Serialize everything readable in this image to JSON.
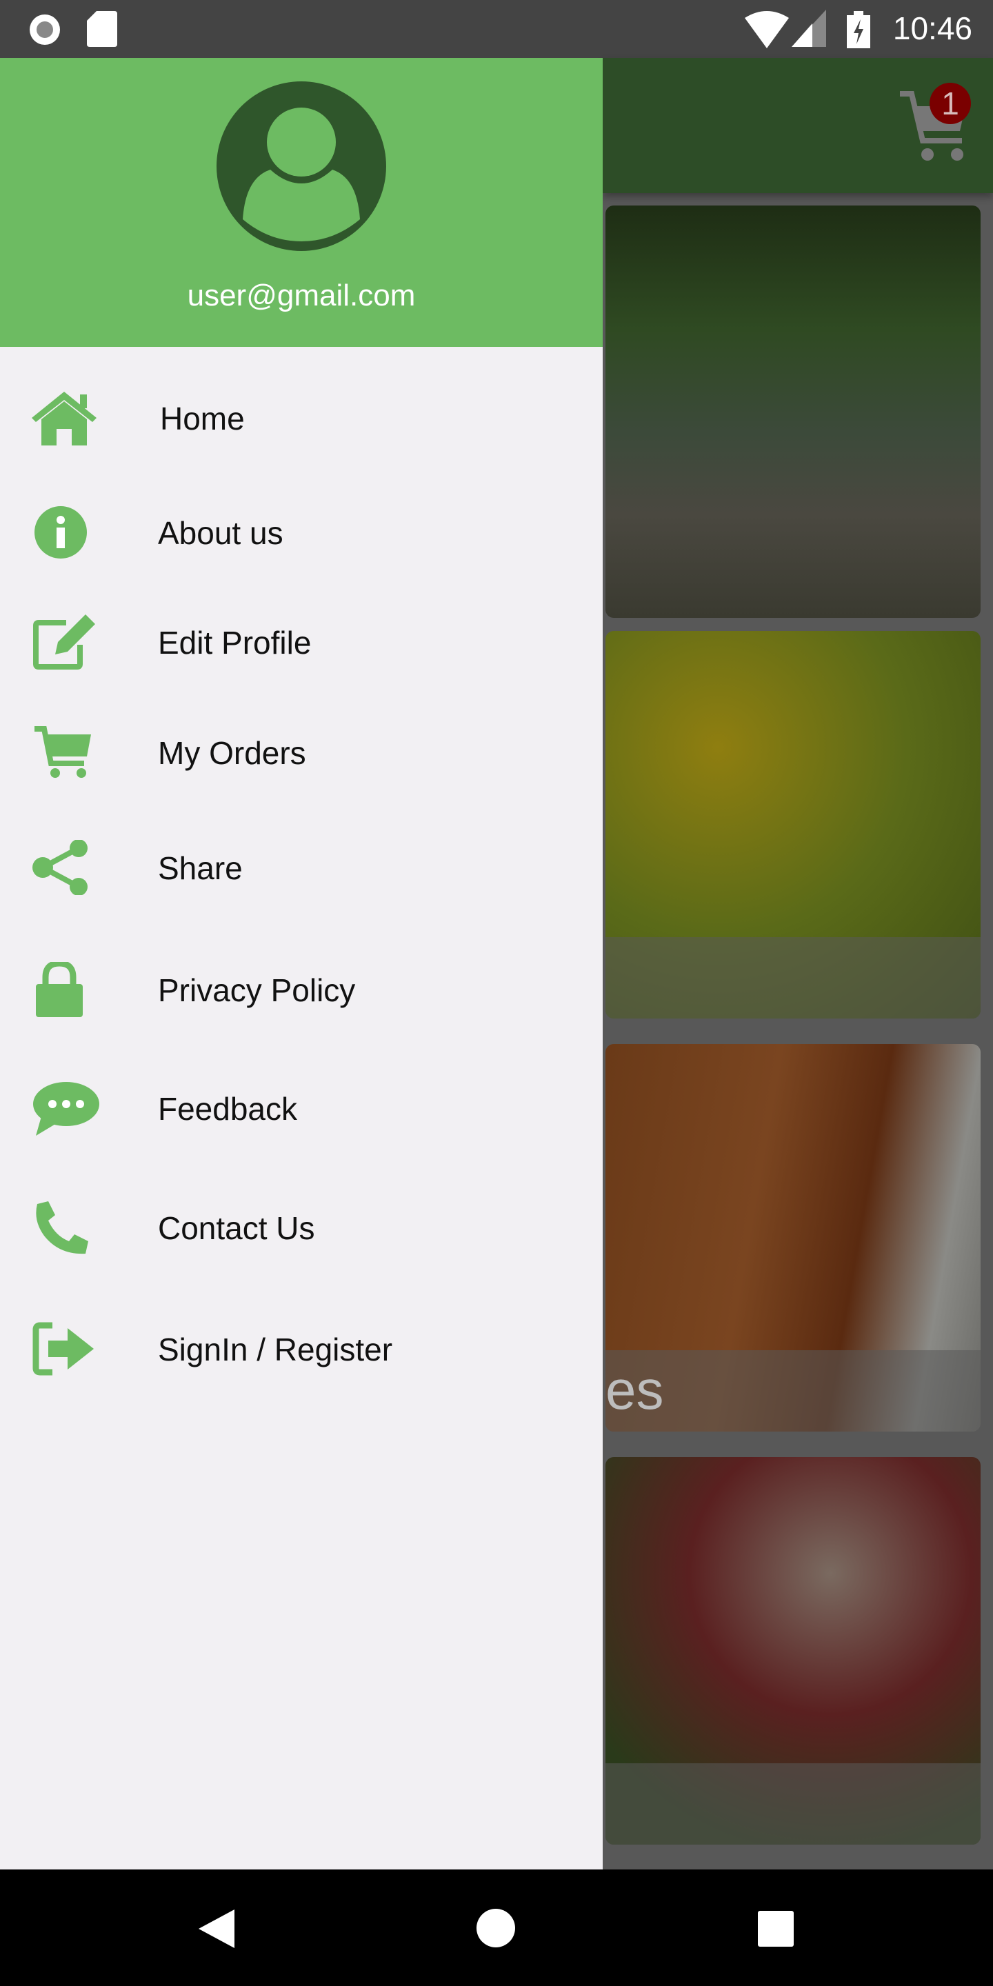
{
  "status_bar": {
    "time": "10:46",
    "icons": [
      "record-icon",
      "sd-card-icon",
      "wifi-icon",
      "signal-icon",
      "battery-charging-icon"
    ]
  },
  "app_bar": {
    "cart_count": "1",
    "cart_icon": "cart-icon",
    "badge_color": "#7a0000"
  },
  "drawer": {
    "header": {
      "email": "user@gmail.com",
      "avatar_icon": "account-circle-icon",
      "bg_color": "#6dbb62"
    },
    "items": [
      {
        "label": "Home",
        "icon": "home-icon"
      },
      {
        "label": "About us",
        "icon": "info-icon"
      },
      {
        "label": "Edit Profile",
        "icon": "edit-icon"
      },
      {
        "label": "My Orders",
        "icon": "cart-icon"
      },
      {
        "label": "Share",
        "icon": "share-icon"
      },
      {
        "label": "Privacy Policy",
        "icon": "lock-icon"
      },
      {
        "label": "Feedback",
        "icon": "chat-icon"
      },
      {
        "label": "Contact Us",
        "icon": "phone-icon"
      },
      {
        "label": "SignIn / Register",
        "icon": "sign-in-icon"
      }
    ],
    "accent": "#6dbb62"
  },
  "cards": [
    {
      "label": ""
    },
    {
      "label": ""
    },
    {
      "label": "es"
    },
    {
      "label": ""
    }
  ],
  "nav_bar": {
    "icons": [
      "back-icon",
      "home-icon",
      "recents-icon"
    ]
  }
}
